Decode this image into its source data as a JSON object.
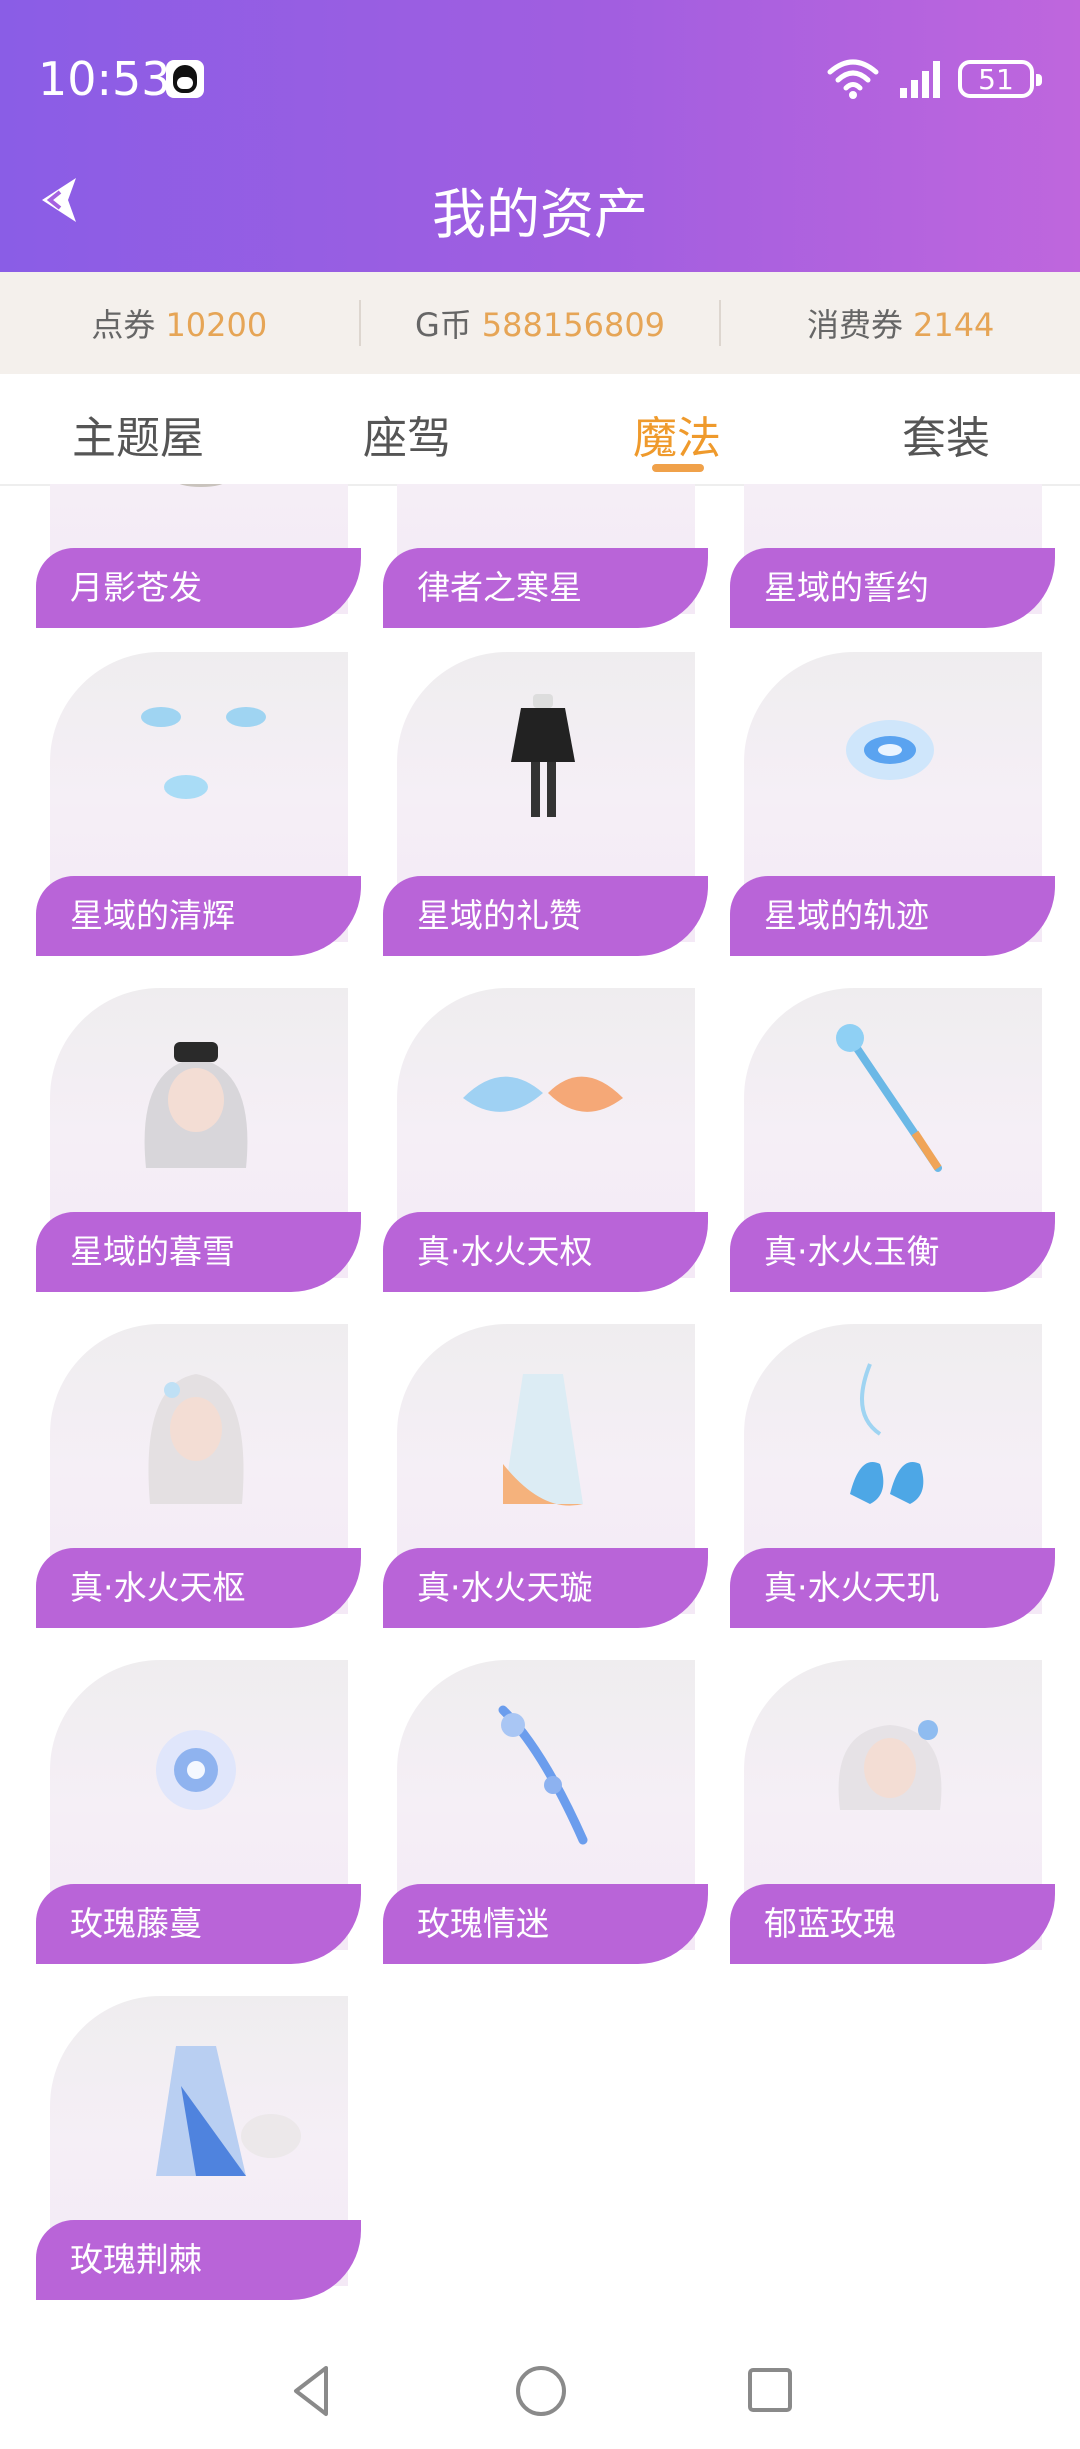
{
  "status_bar": {
    "time": "10:53",
    "battery": "51"
  },
  "header": {
    "title": "我的资产"
  },
  "currency": [
    {
      "label": "点券",
      "value": "10200"
    },
    {
      "label": "G币",
      "value": "588156809"
    },
    {
      "label": "消费券",
      "value": "2144"
    }
  ],
  "tabs": [
    {
      "label": "主题屋",
      "active": false
    },
    {
      "label": "座驾",
      "active": false
    },
    {
      "label": "魔法",
      "active": true
    },
    {
      "label": "套装",
      "active": false
    }
  ],
  "items": [
    "月影苍发",
    "律者之寒星",
    "星域的誓约",
    "星域的清辉",
    "星域的礼赞",
    "星域的轨迹",
    "星域的暮雪",
    "真·水火天权",
    "真·水火玉衡",
    "真·水火天枢",
    "真·水火天璇",
    "真·水火天玑",
    "玫瑰藤蔓",
    "玫瑰情迷",
    "郁蓝玫瑰",
    "玫瑰荆棘"
  ],
  "colors": {
    "accent": "#f0a14a",
    "label_bg": "#b964d8",
    "header_start": "#8a5de6",
    "header_end": "#bf66dd"
  }
}
